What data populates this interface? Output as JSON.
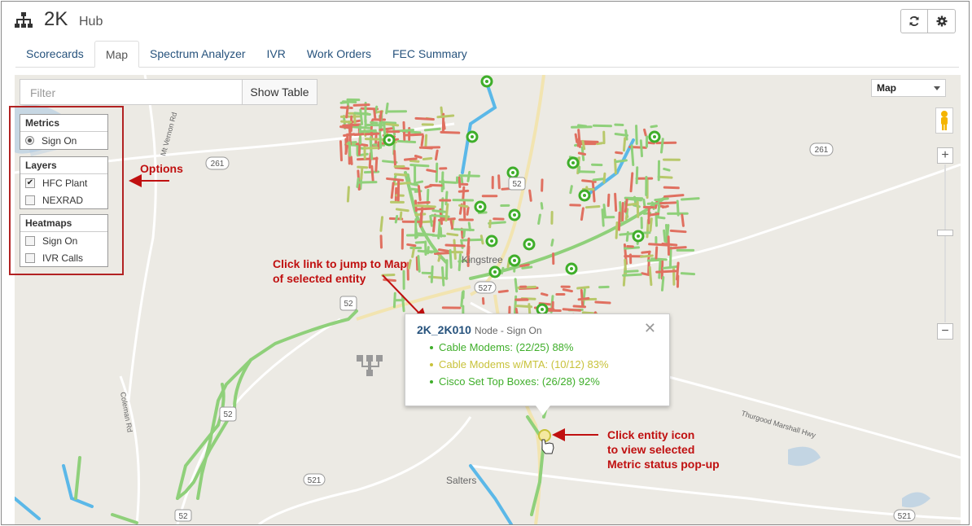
{
  "header": {
    "hub_code": "2K",
    "hub_label": "Hub",
    "refresh_icon": "refresh-icon",
    "settings_icon": "gear-icon",
    "hub_icon": "sitemap-icon"
  },
  "tabs": [
    {
      "label": "Scorecards",
      "active": false
    },
    {
      "label": "Map",
      "active": true
    },
    {
      "label": "Spectrum Analyzer",
      "active": false
    },
    {
      "label": "IVR",
      "active": false
    },
    {
      "label": "Work Orders",
      "active": false
    },
    {
      "label": "FEC Summary",
      "active": false
    }
  ],
  "map": {
    "filter_placeholder": "Filter",
    "show_table_label": "Show Table",
    "map_type": "Map",
    "zoom_in": "+",
    "zoom_out": "−",
    "place_labels": [
      "Kingstree",
      "Salters",
      "Mt Vernon Rd",
      "Coleman Rd",
      "Thurgood Marshall Hwy"
    ],
    "route_shields": [
      "261",
      "261",
      "52",
      "52",
      "527",
      "521",
      "521",
      "52",
      "527"
    ]
  },
  "panels": {
    "metrics": {
      "title": "Metrics",
      "items": [
        {
          "label": "Sign On",
          "checked": true
        }
      ]
    },
    "layers": {
      "title": "Layers",
      "items": [
        {
          "label": "HFC Plant",
          "checked": true
        },
        {
          "label": "NEXRAD",
          "checked": false
        }
      ]
    },
    "heatmaps": {
      "title": "Heatmaps",
      "items": [
        {
          "label": "Sign On",
          "checked": false
        },
        {
          "label": "IVR Calls",
          "checked": false
        }
      ]
    }
  },
  "popup": {
    "node_link": "2K_2K010",
    "node_type": "Node - Sign On",
    "close_symbol": "✕",
    "lines": [
      {
        "text": "Cable Modems: (22/25) 88%",
        "color": "#3fae2a"
      },
      {
        "text": "Cable Modems w/MTA: (10/12) 83%",
        "color": "#c8c23a"
      },
      {
        "text": "Cisco Set Top Boxes: (26/28) 92%",
        "color": "#3fae2a"
      }
    ]
  },
  "annotations": {
    "options": "Options",
    "link_line1": "Click link to jump to Map",
    "link_line2": "of selected entity",
    "icon_line1": "Click entity icon",
    "icon_line2": "to view selected",
    "icon_line3": "Metric status pop-up"
  },
  "colors": {
    "accent_red": "#c01010",
    "link_blue": "#27537d",
    "good": "#3fae2a",
    "warn": "#c8c23a",
    "plant_red": "#e07060",
    "plant_green": "#8fd07a",
    "plant_blue": "#5bb8e8"
  }
}
